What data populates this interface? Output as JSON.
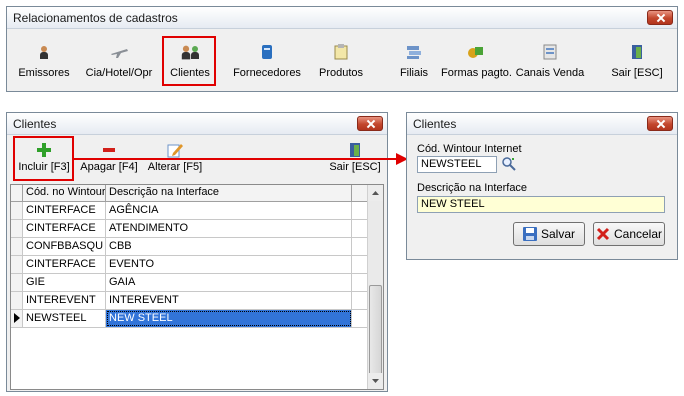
{
  "top_window": {
    "title": "Relacionamentos de cadastros",
    "toolbar": [
      {
        "label": "Emissores",
        "icon": "people-icon"
      },
      {
        "label": "Cia/Hotel/Opr",
        "icon": "airplane-icon"
      },
      {
        "label": "Clientes",
        "icon": "clients-icon"
      },
      {
        "label": "Fornecedores",
        "icon": "supplier-icon"
      },
      {
        "label": "Produtos",
        "icon": "clipboard-icon"
      },
      {
        "label": "Filiais",
        "icon": "branches-icon"
      },
      {
        "label": "Formas pagto.",
        "icon": "payment-icon"
      },
      {
        "label": "Canais Venda",
        "icon": "channels-icon"
      },
      {
        "label": "Sair [ESC]",
        "icon": "exit-door-icon"
      }
    ]
  },
  "clients_window": {
    "title": "Clientes",
    "toolbar": {
      "add": "Incluir [F3]",
      "delete": "Apagar [F4]",
      "edit": "Alterar [F5]",
      "exit": "Sair [ESC]"
    },
    "grid": {
      "columns": [
        "Cód. no Wintour",
        "Descrição na Interface"
      ],
      "rows": [
        [
          "CINTERFACE",
          "AGÊNCIA"
        ],
        [
          "CINTERFACE",
          "ATENDIMENTO"
        ],
        [
          "CONFBBASQU",
          "CBB"
        ],
        [
          "CINTERFACE",
          "EVENTO"
        ],
        [
          "GIE",
          "GAIA"
        ],
        [
          "INTEREVENT",
          "INTEREVENT"
        ],
        [
          "NEWSTEEL",
          "NEW STEEL"
        ]
      ],
      "selected_row": 6
    }
  },
  "edit_window": {
    "title": "Clientes",
    "code_label": "Cód. Wintour Internet",
    "code_value": "NEWSTEEL",
    "desc_label": "Descrição na Interface",
    "desc_value": "NEW STEEL",
    "save_label": "Salvar",
    "cancel_label": "Cancelar"
  },
  "colors": {
    "highlight_box": "#e00000",
    "selection": "#3274d8",
    "desc_field_bg": "#ffffd5"
  }
}
